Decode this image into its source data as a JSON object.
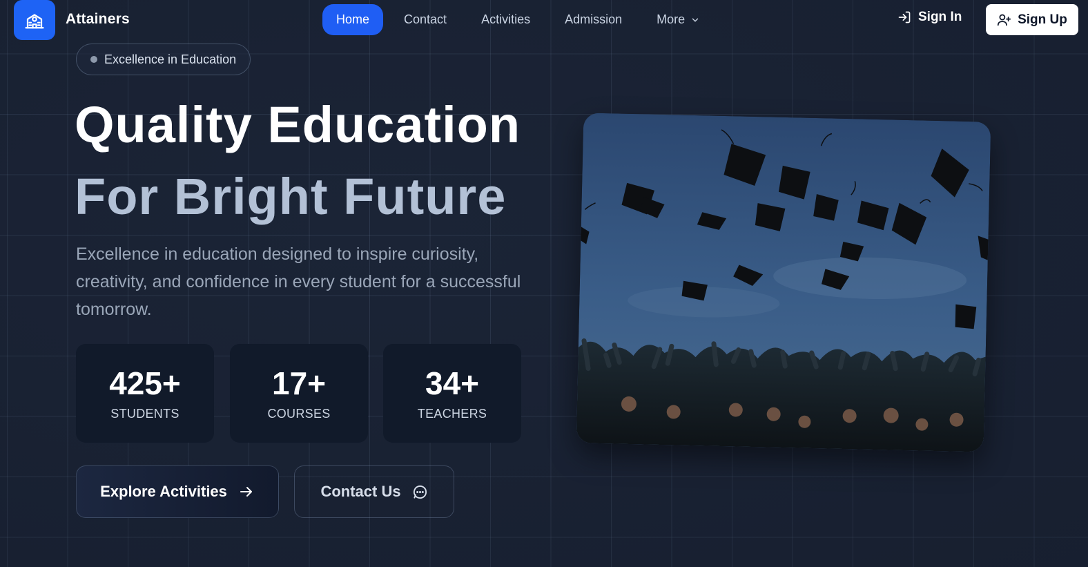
{
  "brand": {
    "name": "Attainers"
  },
  "nav": {
    "items": [
      {
        "label": "Home",
        "active": true
      },
      {
        "label": "Contact"
      },
      {
        "label": "Activities"
      },
      {
        "label": "Admission"
      },
      {
        "label": "More"
      }
    ]
  },
  "auth": {
    "sign_in": "Sign In",
    "sign_up": "Sign Up"
  },
  "hero": {
    "badge": "Excellence in Education",
    "title_line1": "Quality Education",
    "title_line2": "For Bright Future",
    "description": "Excellence in education designed to inspire curiosity, creativity, and confidence in every student for a successful tomorrow.",
    "stats": [
      {
        "value": "425+",
        "label": "STUDENTS"
      },
      {
        "value": "17+",
        "label": "COURSES"
      },
      {
        "value": "34+",
        "label": "TEACHERS"
      }
    ],
    "cta_primary": "Explore Activities",
    "cta_secondary": "Contact Us"
  },
  "colors": {
    "accent": "#1f5ef4",
    "background": "#1b2436",
    "card": "#111a2a"
  },
  "icons": [
    "school-icon",
    "chevron-down-icon",
    "sign-in-icon",
    "user-plus-icon",
    "arrow-right-icon",
    "chat-icon"
  ]
}
